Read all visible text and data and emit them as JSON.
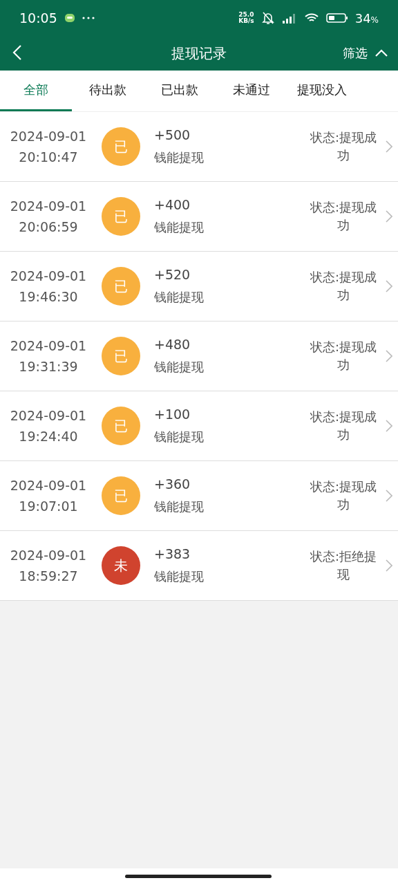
{
  "status_bar": {
    "time": "10:05",
    "speed_value": "25.0",
    "speed_unit": "KB/s",
    "battery": "34",
    "battery_unit": "%"
  },
  "header": {
    "title": "提现记录",
    "filter": "筛选"
  },
  "tabs": [
    {
      "label": "全部",
      "selected": true
    },
    {
      "label": "待出款",
      "selected": false
    },
    {
      "label": "已出款",
      "selected": false
    },
    {
      "label": "未通过",
      "selected": false
    },
    {
      "label": "提现没入",
      "selected": false
    }
  ],
  "records": [
    {
      "date": "2024-09-01",
      "time": "20:10:47",
      "badge": "已",
      "color": "#f8b03e",
      "amount": "+500",
      "type": "钱能提现",
      "status": "状态:提现成功"
    },
    {
      "date": "2024-09-01",
      "time": "20:06:59",
      "badge": "已",
      "color": "#f8b03e",
      "amount": "+400",
      "type": "钱能提现",
      "status": "状态:提现成功"
    },
    {
      "date": "2024-09-01",
      "time": "19:46:30",
      "badge": "已",
      "color": "#f8b03e",
      "amount": "+520",
      "type": "钱能提现",
      "status": "状态:提现成功"
    },
    {
      "date": "2024-09-01",
      "time": "19:31:39",
      "badge": "已",
      "color": "#f8b03e",
      "amount": "+480",
      "type": "钱能提现",
      "status": "状态:提现成功"
    },
    {
      "date": "2024-09-01",
      "time": "19:24:40",
      "badge": "已",
      "color": "#f8b03e",
      "amount": "+100",
      "type": "钱能提现",
      "status": "状态:提现成功"
    },
    {
      "date": "2024-09-01",
      "time": "19:07:01",
      "badge": "已",
      "color": "#f8b03e",
      "amount": "+360",
      "type": "钱能提现",
      "status": "状态:提现成功"
    },
    {
      "date": "2024-09-01",
      "time": "18:59:27",
      "badge": "未",
      "color": "#d0432e",
      "amount": "+383",
      "type": "钱能提现",
      "status": "状态:拒绝提现"
    }
  ]
}
